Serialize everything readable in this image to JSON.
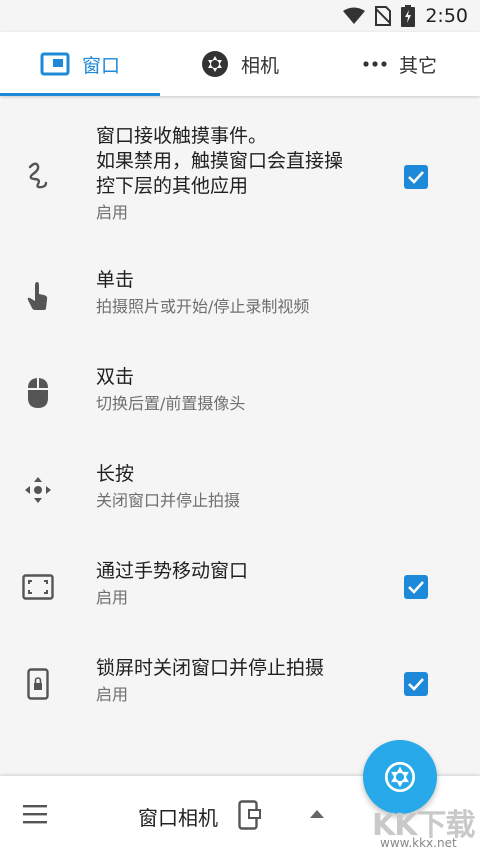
{
  "status_bar": {
    "time": "2:50"
  },
  "tabs": [
    {
      "label": "窗口",
      "icon": "window-icon",
      "active": true
    },
    {
      "label": "相机",
      "icon": "aperture-icon",
      "active": false
    },
    {
      "label": "其它",
      "icon": "more-dots-icon",
      "active": false
    }
  ],
  "settings": [
    {
      "title_line1": "窗口接收触摸事件。",
      "title_line2": "如果禁用，触摸窗口会直接操",
      "title_line3": "控下层的其他应用",
      "summary": "启用",
      "icon": "gesture-icon",
      "checked": true
    },
    {
      "title": "单击",
      "summary": "拍摄照片或开始/停止录制视频",
      "icon": "tap-hand-icon"
    },
    {
      "title": "双击",
      "summary": "切换后置/前置摄像头",
      "icon": "mouse-icon"
    },
    {
      "title": "长按",
      "summary": "关闭窗口并停止拍摄",
      "icon": "move-arrows-icon"
    },
    {
      "title": "通过手势移动窗口",
      "summary": "启用",
      "icon": "fullscreen-frame-icon",
      "checked": true
    },
    {
      "title": "锁屏时关闭窗口并停止拍摄",
      "summary": "启用",
      "icon": "phone-lock-icon",
      "checked": true
    }
  ],
  "bottom_bar": {
    "title": "窗口相机"
  },
  "watermark": {
    "text": "KK下载",
    "url": "www.kkx.net"
  },
  "colors": {
    "accent": "#1e88d9",
    "fab": "#27a9e9",
    "background": "#f5f5f5"
  }
}
